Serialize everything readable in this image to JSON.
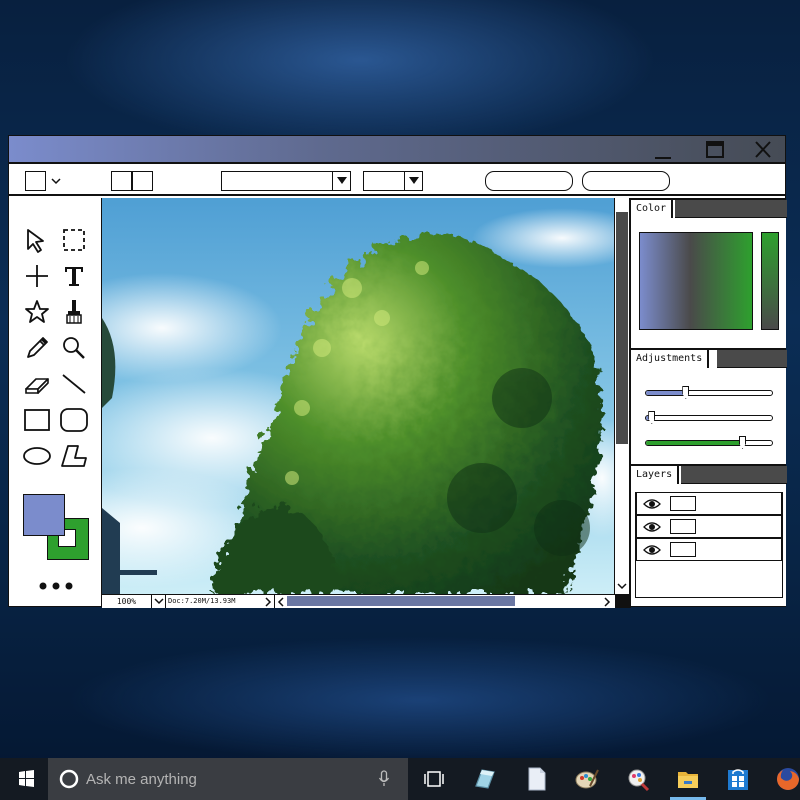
{
  "colors": {
    "accent_blue": "#7b8ccc",
    "accent_green": "#2ea02e",
    "panel_dark": "#4a4a4a"
  },
  "window": {
    "controls": [
      "minimize-icon",
      "maximize-icon",
      "close-icon"
    ]
  },
  "toolbar": {
    "select_dropdown_1_value": "",
    "select_dropdown_2_value": "",
    "button_1_label": "",
    "button_2_label": ""
  },
  "tools": [
    "arrow-select-icon",
    "rectangle-select-icon",
    "crosshair-icon",
    "text-icon",
    "star-icon",
    "brush-icon",
    "pencil-icon",
    "zoom-icon",
    "eraser-icon",
    "line-icon",
    "rectangle-icon",
    "rounded-rectangle-icon",
    "ellipse-icon",
    "polygon-icon"
  ],
  "swatches": {
    "foreground": "#7b8ccc",
    "background": "#2ea02e"
  },
  "status": {
    "zoom": "100%",
    "doc": "Doc:7.20M/13.93M"
  },
  "panels": {
    "color": {
      "title": "Color"
    },
    "adjustments": {
      "title": "Adjustments",
      "sliders": [
        {
          "value": 0.32,
          "fill": "#7b8ccc"
        },
        {
          "value": 0.05,
          "fill": "#7b8ccc"
        },
        {
          "value": 0.77,
          "fill": "#2ea02e"
        }
      ]
    },
    "layers": {
      "title": "Layers",
      "count": 3
    }
  },
  "taskbar": {
    "search_placeholder": "Ask me anything",
    "icons": [
      "windows-start-icon",
      "cortana-icon",
      "microphone-icon",
      "task-view-icon",
      "app-icon",
      "document-icon",
      "paint-palette-icon",
      "paint-app-icon",
      "file-explorer-icon",
      "store-icon",
      "firefox-icon"
    ]
  }
}
